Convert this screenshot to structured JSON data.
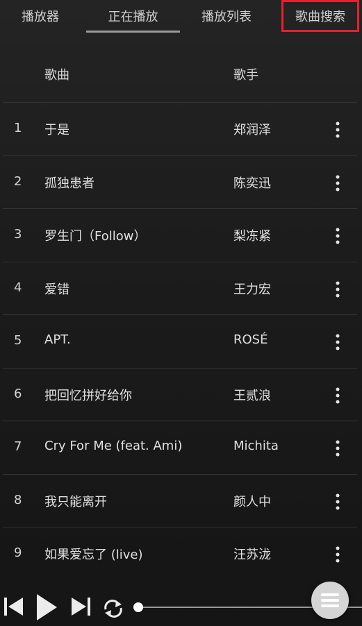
{
  "tabs": {
    "player": "播放器",
    "now_playing": "正在播放",
    "playlist": "播放列表",
    "song_search": "歌曲搜索"
  },
  "list_header": {
    "song": "歌曲",
    "artist": "歌手"
  },
  "songs": [
    {
      "index": "1",
      "title": "于是",
      "artist": "郑润泽"
    },
    {
      "index": "2",
      "title": "孤独患者",
      "artist": "陈奕迅"
    },
    {
      "index": "3",
      "title": "罗生门（Follow）",
      "artist": "梨冻紧"
    },
    {
      "index": "4",
      "title": "爱错",
      "artist": "王力宏"
    },
    {
      "index": "5",
      "title": "APT.",
      "artist": "ROSÉ"
    },
    {
      "index": "6",
      "title": "把回忆拼好给你",
      "artist": "王贰浪"
    },
    {
      "index": "7",
      "title": "Cry For Me (feat. Ami)",
      "artist": "Michita"
    },
    {
      "index": "8",
      "title": "我只能离开",
      "artist": "颜人中"
    },
    {
      "index": "9",
      "title": "如果爱忘了 (live)",
      "artist": "汪苏泷"
    }
  ],
  "controls": {
    "prev_icon": "skip-previous-icon",
    "play_icon": "play-icon",
    "next_icon": "skip-next-icon",
    "repeat_icon": "repeat-icon",
    "menu_icon": "hamburger-menu-icon",
    "progress_fraction": 0.0
  },
  "colors": {
    "highlight_border": "#e2232f",
    "active_tab_underline": "#9a9a9a"
  }
}
